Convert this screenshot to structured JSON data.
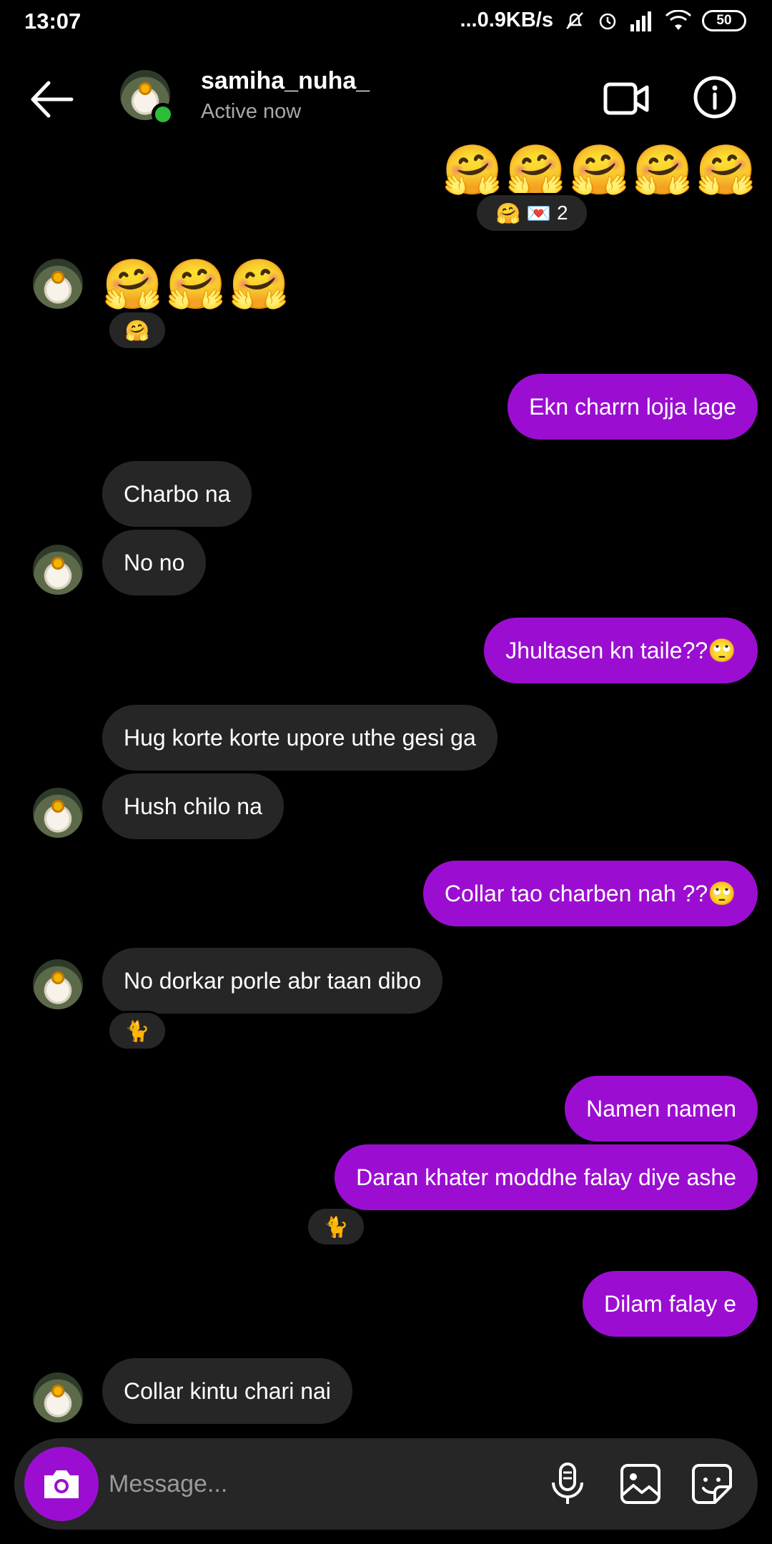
{
  "status_bar": {
    "time": "13:07",
    "network_speed": "...0.9KB/s",
    "battery": "50"
  },
  "header": {
    "username": "samiha_nuha_",
    "status": "Active now",
    "icons": [
      "back-arrow-icon",
      "video-call-icon",
      "info-icon"
    ]
  },
  "messages": [
    {
      "side": "out",
      "type": "emoji",
      "text": "🤗🤗🤗🤗🤗",
      "reaction": {
        "emoji": "🤗 💌",
        "count": "2"
      }
    },
    {
      "side": "in",
      "type": "emoji",
      "text": "🤗🤗🤗",
      "reaction": {
        "emoji": "🤗"
      }
    },
    {
      "side": "out",
      "text": "Ekn charrn lojja lage"
    },
    {
      "side": "in",
      "text": "Charbo na"
    },
    {
      "side": "in",
      "text": "No no"
    },
    {
      "side": "out",
      "text": "Jhultasen kn taile??🙄"
    },
    {
      "side": "in",
      "text": "Hug korte korte upore uthe gesi ga"
    },
    {
      "side": "in",
      "text": "Hush chilo na"
    },
    {
      "side": "out",
      "text": "Collar tao charben nah ??🙄"
    },
    {
      "side": "in",
      "text": "No dorkar porle abr taan dibo",
      "reaction": {
        "emoji": "🐈"
      }
    },
    {
      "side": "out",
      "text": "Namen namen"
    },
    {
      "side": "out",
      "text": "Daran khater moddhe falay diye ashe",
      "reaction": {
        "emoji": "🐈"
      }
    },
    {
      "side": "out",
      "text": "Dilam falay e"
    },
    {
      "side": "in",
      "text": "Collar kintu chari nai"
    }
  ],
  "composer": {
    "placeholder": "Message..."
  },
  "colors": {
    "outgoing_bubble": "#9b0ed1",
    "incoming_bubble": "#262626",
    "online": "#2bbd38"
  }
}
